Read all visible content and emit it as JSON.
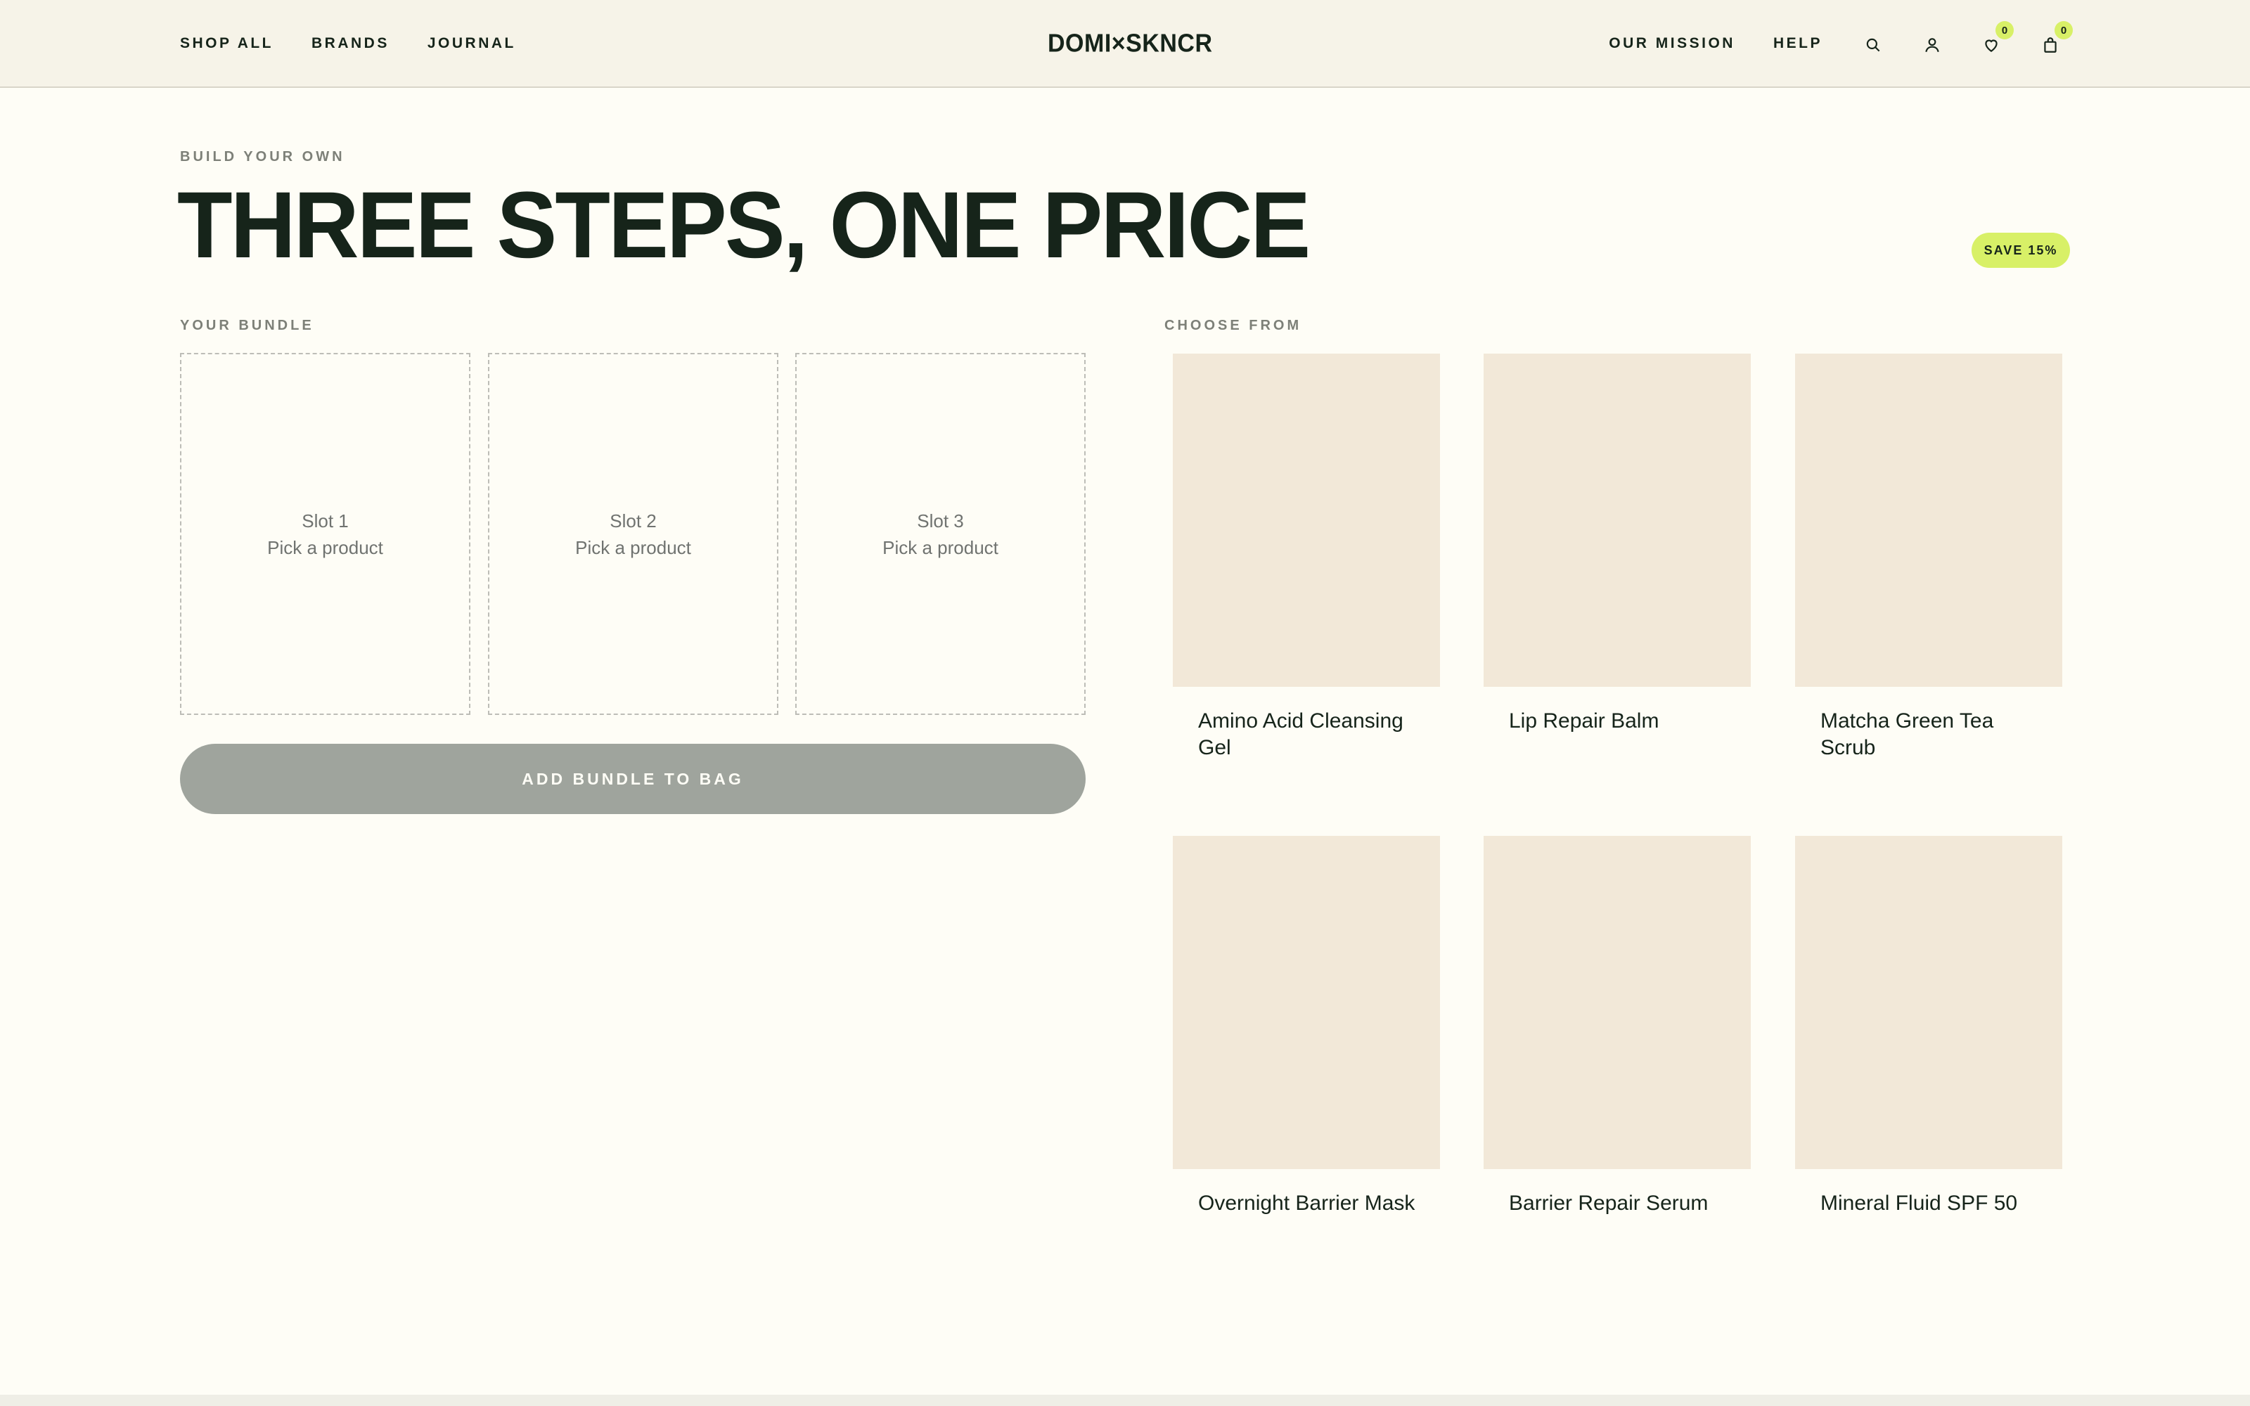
{
  "header": {
    "nav_left": [
      "SHOP ALL",
      "BRANDS",
      "JOURNAL"
    ],
    "logo": "DOMI×SKNCR",
    "nav_right": [
      "OUR MISSION",
      "HELP"
    ],
    "wishlist_count": "0",
    "cart_count": "0"
  },
  "hero": {
    "eyebrow": "BUILD YOUR OWN",
    "title": "THREE STEPS, ONE PRICE",
    "badge": "SAVE 15%"
  },
  "bundle": {
    "label": "YOUR BUNDLE",
    "slots": [
      {
        "title": "Slot 1",
        "hint": "Pick a product"
      },
      {
        "title": "Slot 2",
        "hint": "Pick a product"
      },
      {
        "title": "Slot 3",
        "hint": "Pick a product"
      }
    ],
    "add_button": "ADD BUNDLE TO BAG"
  },
  "catalog": {
    "label": "CHOOSE FROM",
    "products": [
      {
        "name": "Amino Acid Cleansing Gel"
      },
      {
        "name": "Lip Repair Balm"
      },
      {
        "name": "Matcha Green Tea Scrub"
      },
      {
        "name": "Overnight Barrier Mask"
      },
      {
        "name": "Barrier Repair Serum"
      },
      {
        "name": "Mineral Fluid SPF 50"
      }
    ]
  },
  "colors": {
    "accent": "#d8f067",
    "ink": "#16241a",
    "product_placeholder": "#f2e8d8",
    "disabled_button": "#9fa49d"
  },
  "icons": [
    "search-icon",
    "user-icon",
    "heart-icon",
    "bag-icon"
  ]
}
